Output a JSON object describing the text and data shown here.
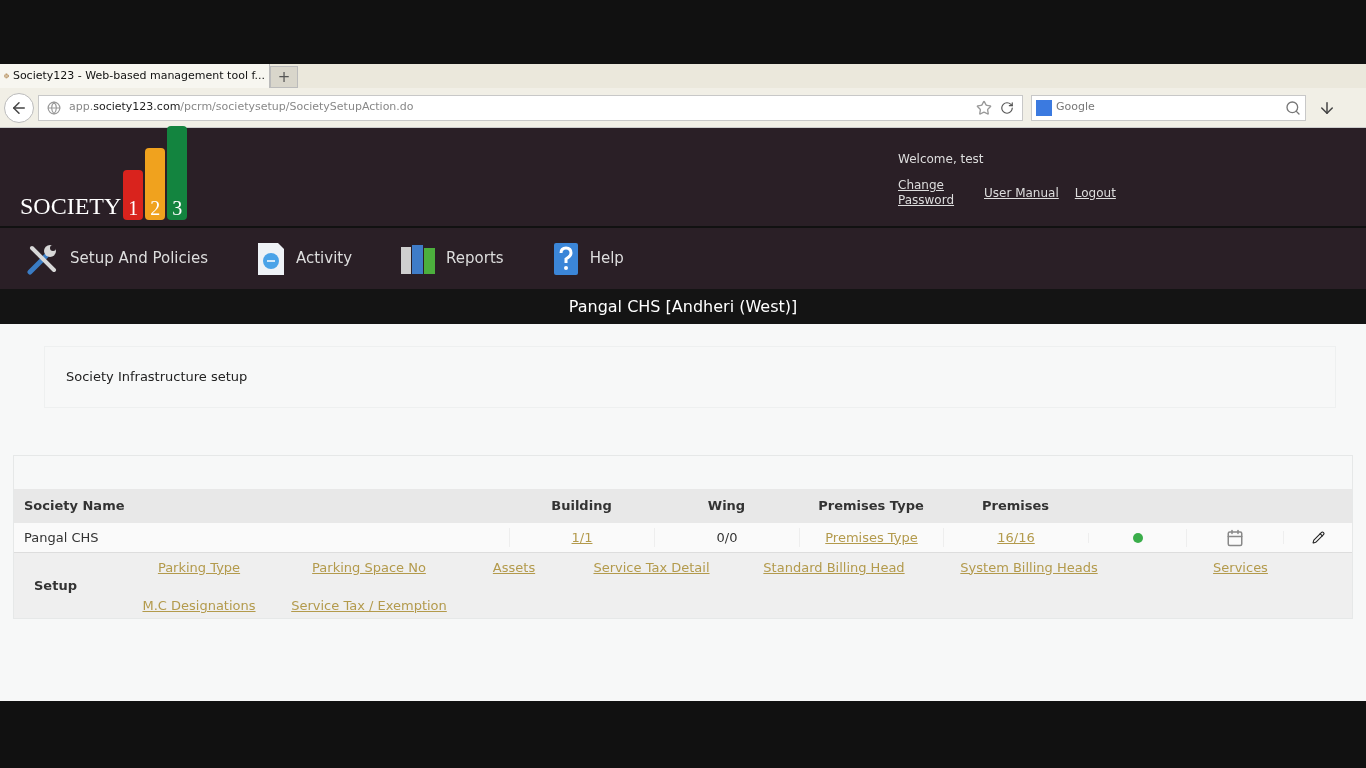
{
  "browser": {
    "tab_title": "Society123 - Web-based management tool f...",
    "new_tab": "+",
    "url_host": "app.",
    "url_domain": "society123.com",
    "url_path": "/pcrm/societysetup/SocietySetupAction.do",
    "search_placeholder": "Google"
  },
  "logo": {
    "word": "SOCIETY",
    "digits": [
      {
        "text": "1",
        "color": "#d9231d"
      },
      {
        "text": "2",
        "color": "#f0a21e"
      },
      {
        "text": "3",
        "color": "#13843f"
      }
    ]
  },
  "user": {
    "welcome": "Welcome, test",
    "links": [
      "Change Password",
      "User Manual",
      "Logout"
    ]
  },
  "menu": [
    {
      "label": "Setup And Policies",
      "kind": "tools"
    },
    {
      "label": "Activity",
      "kind": "clock"
    },
    {
      "label": "Reports",
      "kind": "binders"
    },
    {
      "label": "Help",
      "kind": "help"
    }
  ],
  "society_title": "Pangal CHS [Andheri (West)]",
  "section_title": "Society Infrastructure setup",
  "table": {
    "columns": [
      "Society Name",
      "Building",
      "Wing",
      "Premises Type",
      "Premises"
    ],
    "rows": [
      {
        "society_name": "Pangal CHS",
        "building": "1/1",
        "wing": "0/0",
        "premises_type": "Premises Type",
        "premises": "16/16",
        "color": "#3aad4a"
      }
    ]
  },
  "setup": {
    "label": "Setup",
    "links": [
      [
        "Parking Type",
        "Parking Space No",
        "Assets",
        "Service Tax Detail",
        "Standard Billing Head",
        "System Billing Heads",
        "Services"
      ],
      [
        "M.C Designations",
        "Service Tax / Exemption"
      ]
    ]
  }
}
